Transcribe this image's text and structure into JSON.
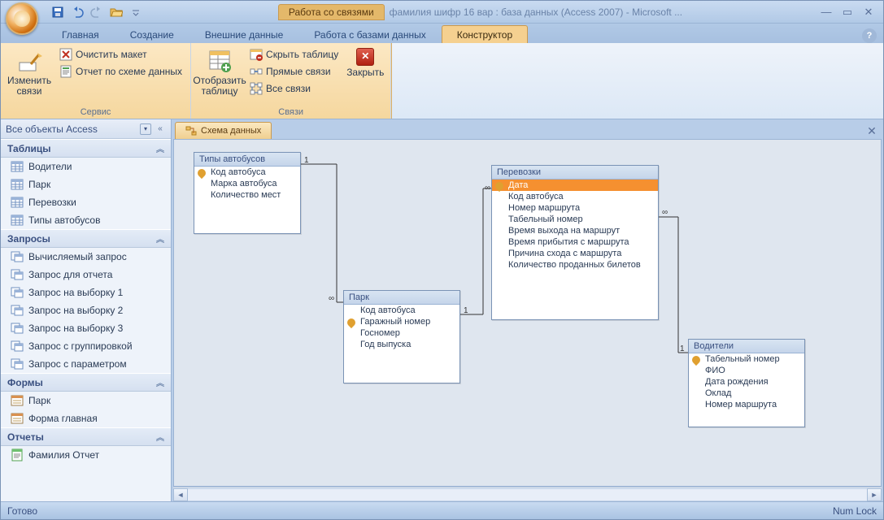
{
  "title": {
    "context_tab": "Работа со связями",
    "text": "фамилия шифр 16 вар : база данных (Access 2007) - Microsoft ..."
  },
  "tabs": {
    "home": "Главная",
    "create": "Создание",
    "external": "Внешние данные",
    "dbtools": "Работа с базами данных",
    "design": "Конструктор"
  },
  "ribbon": {
    "edit_rel": "Изменить связи",
    "clear_layout": "Очистить макет",
    "rel_report": "Отчет по схеме данных",
    "group_service": "Сервис",
    "show_table": "Отобразить таблицу",
    "hide_table": "Скрыть таблицу",
    "direct_rel": "Прямые связи",
    "all_rel": "Все связи",
    "group_rel": "Связи",
    "close": "Закрыть"
  },
  "nav": {
    "header": "Все объекты Access",
    "sec_tables": "Таблицы",
    "tables": [
      "Водители",
      "Парк",
      "Перевозки",
      "Типы автобусов"
    ],
    "sec_queries": "Запросы",
    "queries": [
      "Вычисляемый запрос",
      "Запрос для отчета",
      "Запрос на выборку 1",
      "Запрос на выборку 2",
      "Запрос на выборку 3",
      "Запрос с группировкой",
      "Запрос с параметром"
    ],
    "sec_forms": "Формы",
    "forms": [
      "Парк",
      "Форма главная"
    ],
    "sec_reports": "Отчеты",
    "reports": [
      "Фамилия Отчет"
    ]
  },
  "doc_tab": "Схема данных",
  "schema": {
    "bus_types": {
      "title": "Типы автобусов",
      "fields": [
        "Код автобуса",
        "Марка автобуса",
        "Количество мест"
      ]
    },
    "park": {
      "title": "Парк",
      "fields": [
        "Код автобуса",
        "Гаражный номер",
        "Госномер",
        "Год выпуска"
      ]
    },
    "trips": {
      "title": "Перевозки",
      "fields": [
        "Дата",
        "Код автобуса",
        "Номер маршрута",
        "Табельный номер",
        "Время выхода на маршрут",
        "Время прибытия с маршрута",
        "Причина схода с маршрута",
        "Количество проданных билетов"
      ]
    },
    "drivers": {
      "title": "Водители",
      "fields": [
        "Табельный номер",
        "ФИО",
        "Дата рождения",
        "Оклад",
        "Номер маршрута"
      ]
    }
  },
  "status": {
    "left": "Готово",
    "right": "Num Lock"
  }
}
